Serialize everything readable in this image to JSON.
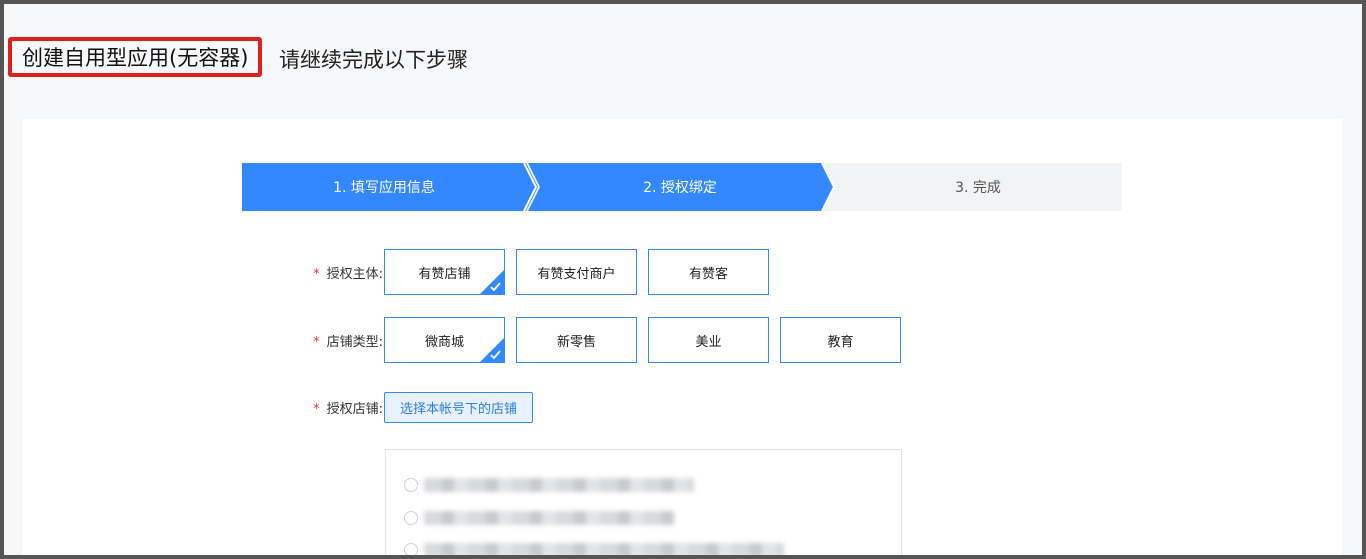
{
  "header": {
    "title": "创建自用型应用(无容器)",
    "subtitle": "请继续完成以下步骤"
  },
  "steps": [
    {
      "label": "1. 填写应用信息",
      "state": "active"
    },
    {
      "label": "2. 授权绑定",
      "state": "active"
    },
    {
      "label": "3. 完成",
      "state": "inactive"
    }
  ],
  "form": {
    "auth_subject": {
      "required_mark": "*",
      "label": "授权主体:",
      "options": [
        "有赞店铺",
        "有赞支付商户",
        "有赞客"
      ],
      "selected": "有赞店铺"
    },
    "shop_type": {
      "required_mark": "*",
      "label": "店铺类型:",
      "options": [
        "微商城",
        "新零售",
        "美业",
        "教育"
      ],
      "selected": "微商城"
    },
    "auth_shop": {
      "required_mark": "*",
      "label": "授权店铺:",
      "button_label": "选择本帐号下的店铺"
    }
  },
  "colors": {
    "accent": "#3388ff",
    "highlight_border": "#e02020",
    "step_active": "#3388ff",
    "step_inactive": "#f2f3f5"
  }
}
